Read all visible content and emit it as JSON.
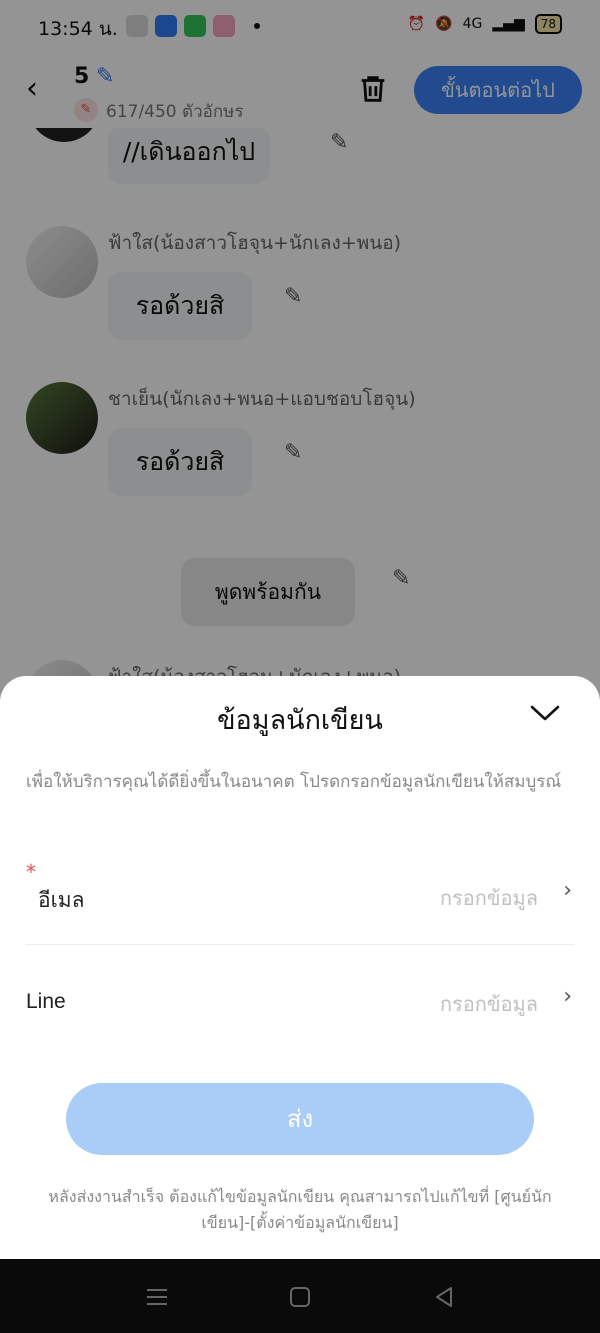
{
  "status_bar": {
    "time": "13:54 น.",
    "battery": "78",
    "network": "4G",
    "app_icon_colors": [
      "#d9d9d9",
      "#2f7bf6",
      "#34c759",
      "#f4a4c0"
    ]
  },
  "header": {
    "count": "5",
    "char_count": "617/450 ตัวอักษร",
    "next_label": "ขั้นตอนต่อไป",
    "accent_color": "#3b82f6"
  },
  "chat": {
    "items": [
      {
        "text": "//เดินออกไป"
      },
      {
        "name": "ฟ้าใส(น้องสาวโฮจุน+นักเลง+พนอ)",
        "text": "รอด้วยสิ"
      },
      {
        "name": "ชาเย็น(นักเลง+พนอ+แอบชอบโฮจุน)",
        "text": "รอด้วยสิ"
      },
      {
        "text": "พูดพร้อมกัน"
      },
      {
        "name": "ฟ้าใส(น้องสาวโฮจุน+นักเลง+พนอ)"
      }
    ]
  },
  "sheet": {
    "title": "ข้อมูลนักเขียน",
    "note": "เพื่อให้บริการคุณได้ดียิ่งขึ้นในอนาคต โปรดกรอกข้อมูลนักเขียนให้สมบูรณ์",
    "fields": [
      {
        "label": "อีเมล",
        "required_mark": "*",
        "placeholder": "กรอกข้อมูล"
      },
      {
        "label": "Line",
        "placeholder": "กรอกข้อมูล"
      }
    ],
    "submit_label": "ส่ง",
    "footer_note": "หลังส่งงานสำเร็จ ต้องแก้ไขข้อมูลนักเขียน คุณสามารถไปแก้ไขที่ [ศูนย์นักเขียน]-[ตั้งค่าข้อมูลนักเขียน]",
    "submit_color": "#a9cdf6",
    "required_color": "#e94e4e"
  }
}
